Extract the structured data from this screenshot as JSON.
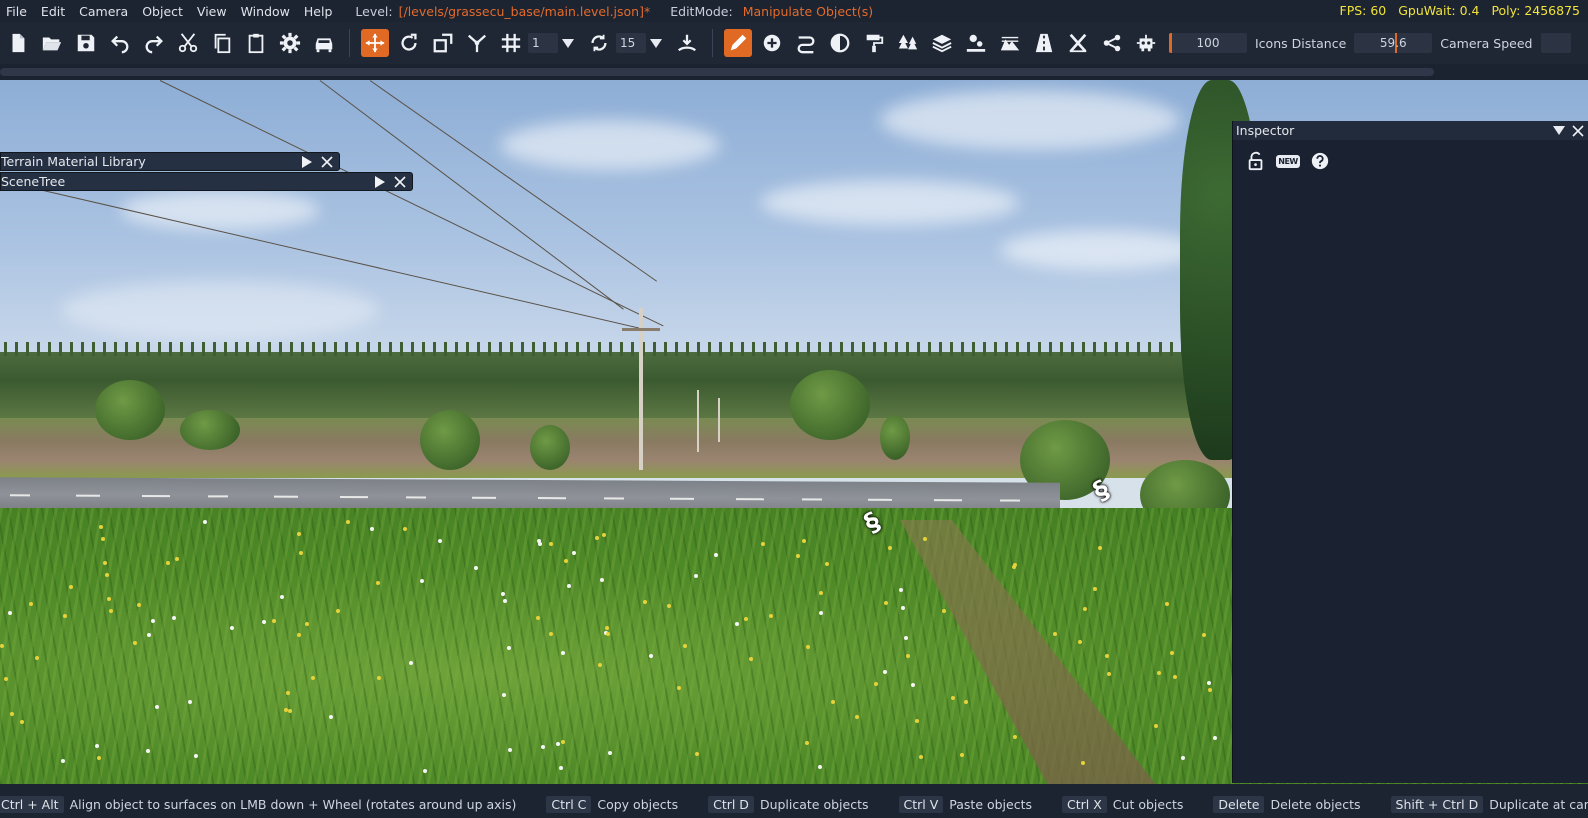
{
  "menubar": {
    "menus": [
      "File",
      "Edit",
      "Camera",
      "Object",
      "View",
      "Window",
      "Help"
    ],
    "level_label": "Level:",
    "level_path": "[/levels/grassecu_base/main.level.json]*",
    "editmode_label": "EditMode:",
    "editmode_value": "Manipulate Object(s)",
    "fps": "FPS: 60",
    "gpuwait": "GpuWait: 0.4",
    "poly": "Poly: 2456875"
  },
  "toolbar": {
    "snap_value": "1",
    "rotate_snap_value": "15",
    "slider_value": "100",
    "icons_distance_label": "Icons Distance",
    "icons_distance_value": "59.6",
    "camera_speed_label": "Camera Speed",
    "slider_fill": 0.04,
    "icons_distance_fill": 0.55
  },
  "panels": {
    "terrain_material_library": "Terrain Material Library",
    "scene_tree": "SceneTree"
  },
  "inspector": {
    "title": "Inspector",
    "new_badge": "NEW"
  },
  "statusbar": {
    "hints": [
      {
        "keys": "Ctrl + Alt",
        "text": "Align object to surfaces on LMB down + Wheel (rotates around up axis)"
      },
      {
        "keys": "Ctrl C",
        "text": "Copy objects"
      },
      {
        "keys": "Ctrl D",
        "text": "Duplicate objects"
      },
      {
        "keys": "Ctrl V",
        "text": "Paste objects"
      },
      {
        "keys": "Ctrl X",
        "text": "Cut objects"
      },
      {
        "keys": "Delete",
        "text": "Delete objects"
      },
      {
        "keys": "Shift + Ctrl D",
        "text": "Duplicate at cam pos"
      }
    ]
  },
  "colors": {
    "accent": "#e06a23",
    "stats": "#f0e33c",
    "panel_bg": "#1a2131"
  }
}
